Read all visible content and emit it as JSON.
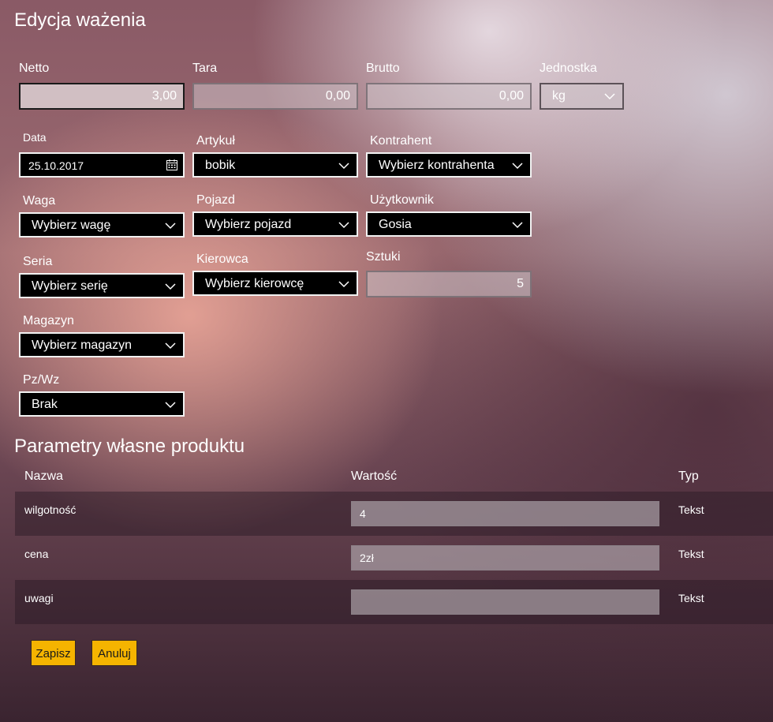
{
  "page_title": "Edycja ważenia",
  "weights": {
    "netto": {
      "label": "Netto",
      "value": "3,00"
    },
    "tara": {
      "label": "Tara",
      "value": "0,00"
    },
    "brutto": {
      "label": "Brutto",
      "value": "0,00"
    },
    "jednostka": {
      "label": "Jednostka",
      "value": "kg"
    }
  },
  "form": {
    "data": {
      "label": "Data",
      "value": "25.10.2017"
    },
    "artykul": {
      "label": "Artykuł",
      "value": "bobik"
    },
    "kontrahent": {
      "label": "Kontrahent",
      "value": "Wybierz kontrahenta"
    },
    "waga": {
      "label": "Waga",
      "value": "Wybierz wagę"
    },
    "pojazd": {
      "label": "Pojazd",
      "value": "Wybierz pojazd"
    },
    "uzytkownik": {
      "label": "Użytkownik",
      "value": "Gosia"
    },
    "seria": {
      "label": "Seria",
      "value": "Wybierz serię"
    },
    "kierowca": {
      "label": "Kierowca",
      "value": "Wybierz kierowcę"
    },
    "sztuki": {
      "label": "Sztuki",
      "value": "5"
    },
    "magazyn": {
      "label": "Magazyn",
      "value": "Wybierz magazyn"
    },
    "pzwz": {
      "label": "Pz/Wz",
      "value": "Brak"
    }
  },
  "params": {
    "title": "Parametry własne produktu",
    "columns": {
      "name": "Nazwa",
      "value": "Wartość",
      "type": "Typ"
    },
    "rows": [
      {
        "name": "wilgotność",
        "value": "4",
        "type": "Tekst"
      },
      {
        "name": "cena",
        "value": "2zł",
        "type": "Tekst"
      },
      {
        "name": "uwagi",
        "value": "",
        "type": "Tekst"
      }
    ]
  },
  "buttons": {
    "save": "Zapisz",
    "cancel": "Anuluj"
  },
  "colors": {
    "accent_button": "#f5b400",
    "combo_bg": "#000000"
  }
}
